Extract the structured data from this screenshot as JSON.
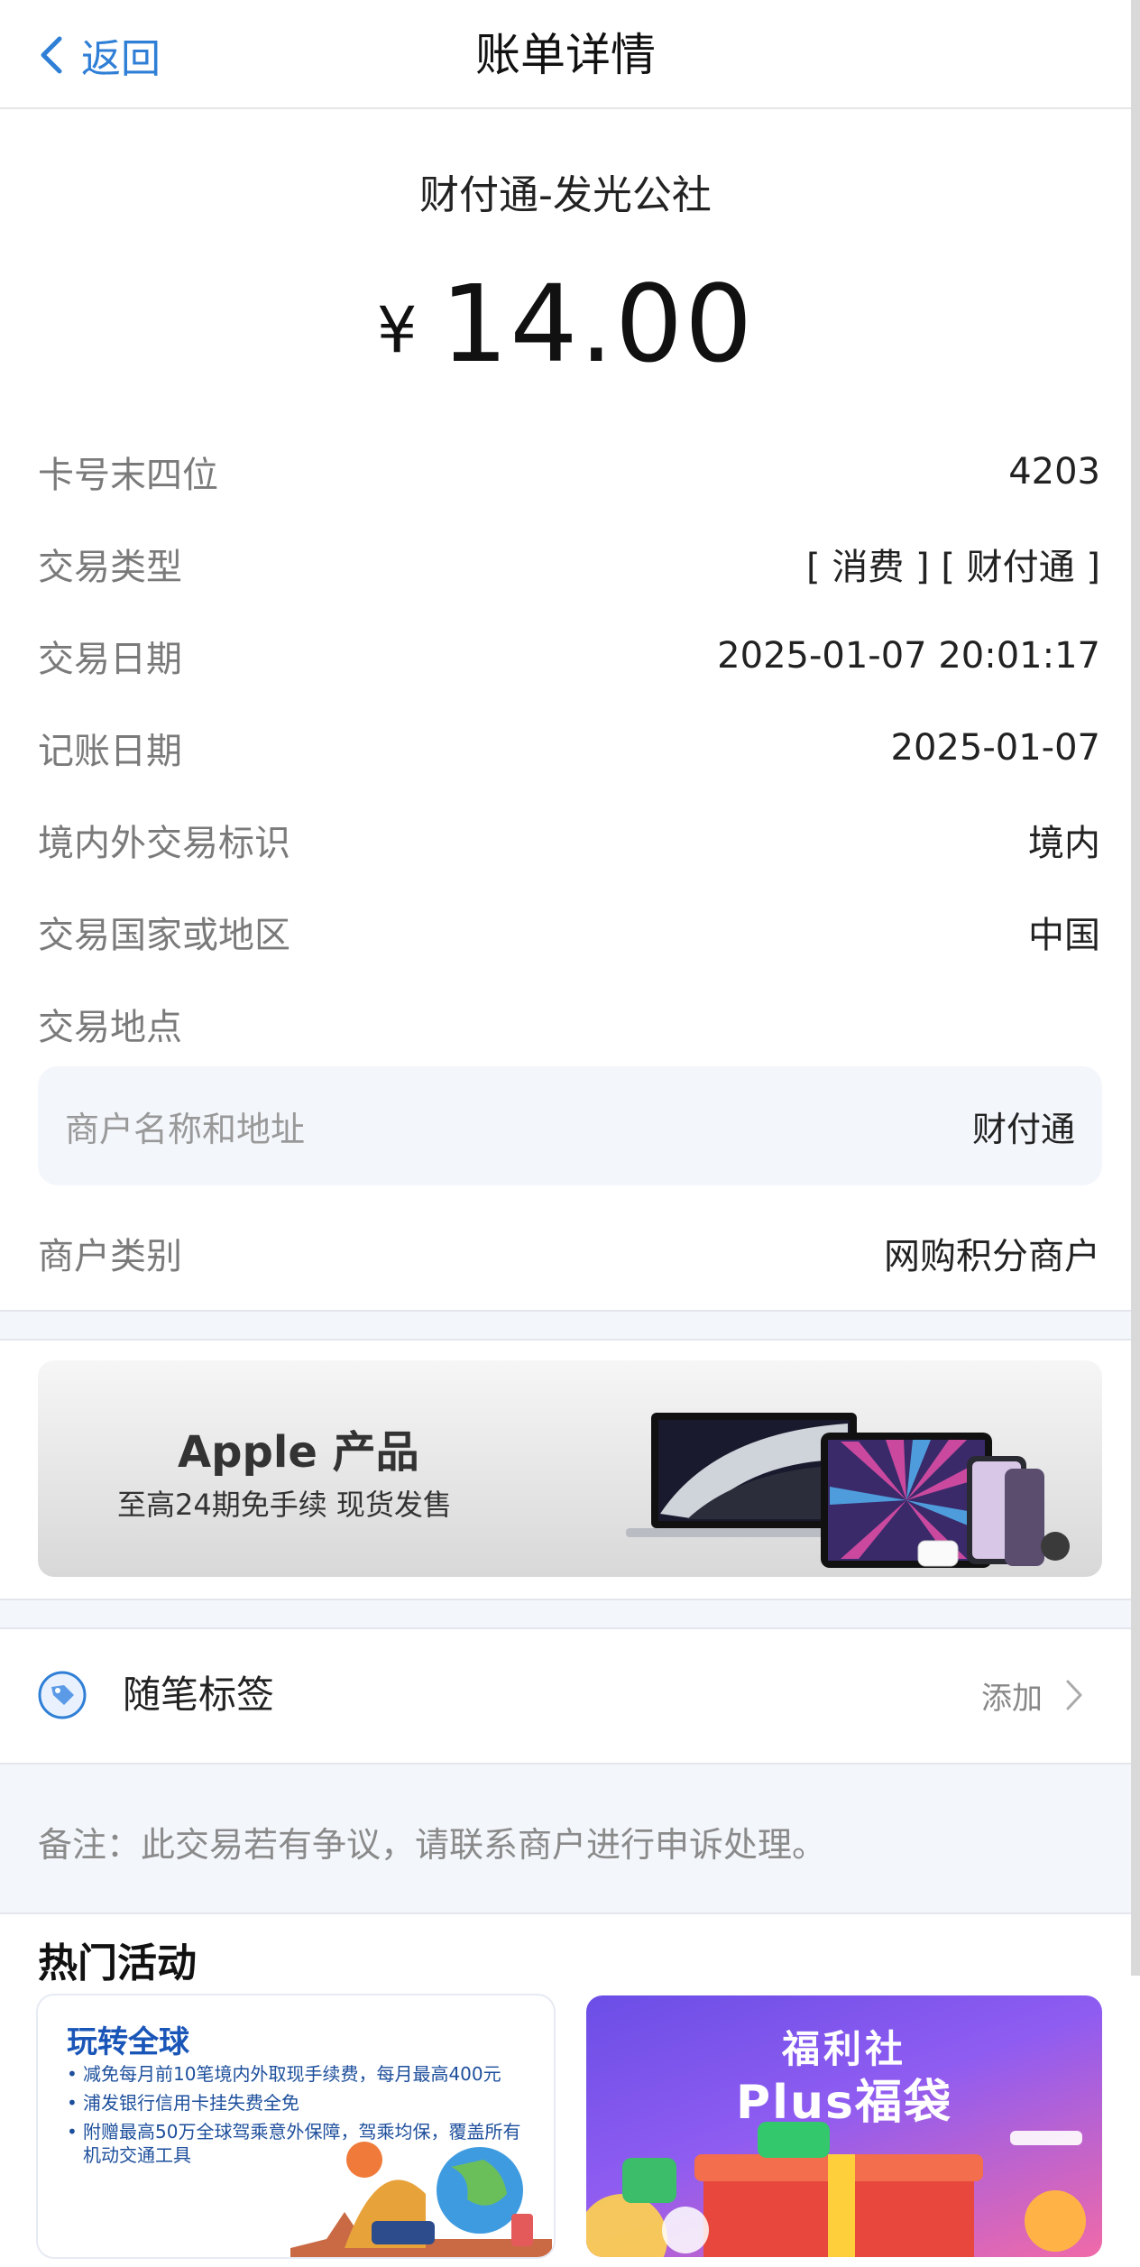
{
  "header": {
    "back_label": "返回",
    "title": "账单详情"
  },
  "bill": {
    "merchant_title": "财付通-发光公社",
    "currency_symbol": "¥",
    "amount": "14.00"
  },
  "details": [
    {
      "label": "卡号末四位",
      "value": "4203"
    },
    {
      "label": "交易类型",
      "value": "[ 消费 ] [ 财付通 ]"
    },
    {
      "label": "交易日期",
      "value": "2025-01-07 20:01:17"
    },
    {
      "label": "记账日期",
      "value": "2025-01-07"
    },
    {
      "label": "境内外交易标识",
      "value": "境内"
    },
    {
      "label": "交易国家或地区",
      "value": "中国"
    }
  ],
  "location": {
    "label": "交易地点",
    "merchant_name_label": "商户名称和地址",
    "merchant_name_value": "财付通"
  },
  "merchant_category": {
    "label": "商户类别",
    "value": "网购积分商户"
  },
  "banner": {
    "title": "Apple 产品",
    "subtitle": "至高24期免手续 现货发售"
  },
  "tags": {
    "label": "随笔标签",
    "action": "添加"
  },
  "note": "备注：此交易若有争议，请联系商户进行申诉处理。",
  "hot": {
    "title": "热门活动",
    "card1": {
      "title": "玩转全球",
      "items": [
        "减免每月前10笔境内外取现手续费，每月最高400元",
        "浦发银行信用卡挂失费全免",
        "附赠最高50万全球驾乘意外保障，驾乘均保，覆盖所有机动交通工具"
      ]
    },
    "card2": {
      "line1": "福利社",
      "line2": "Plus福袋"
    }
  },
  "colors": {
    "accent": "#2f7fd6",
    "section_bg": "#f3f6fb"
  }
}
